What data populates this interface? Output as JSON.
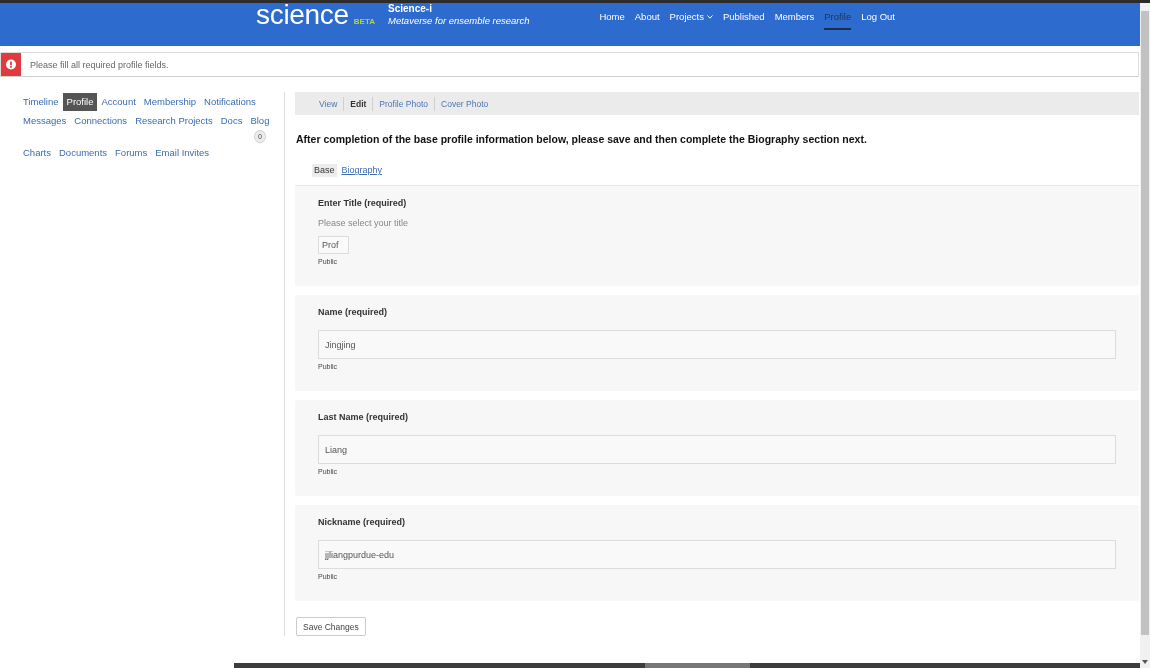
{
  "header": {
    "logo": {
      "wordmark": "science",
      "badge": "BETA"
    },
    "site_name": "Science-i",
    "tagline": "Metaverse for ensemble research",
    "nav": [
      {
        "label": "Home",
        "selected": false,
        "dropdown": false
      },
      {
        "label": "About",
        "selected": false,
        "dropdown": false
      },
      {
        "label": "Projects",
        "selected": false,
        "dropdown": true
      },
      {
        "label": "Published",
        "selected": false,
        "dropdown": false
      },
      {
        "label": "Members",
        "selected": false,
        "dropdown": false
      },
      {
        "label": "Profile",
        "selected": true,
        "dropdown": false
      },
      {
        "label": "Log Out",
        "selected": false,
        "dropdown": false
      }
    ]
  },
  "alert": {
    "kind": "error",
    "text": "Please fill all required profile fields."
  },
  "sidebar": {
    "items": [
      {
        "label": "Timeline",
        "selected": false
      },
      {
        "label": "Profile",
        "selected": true
      },
      {
        "label": "Account",
        "selected": false
      },
      {
        "label": "Membership",
        "selected": false
      },
      {
        "label": "Notifications",
        "selected": false
      },
      {
        "label": "Messages",
        "selected": false
      },
      {
        "label": "Connections",
        "selected": false
      },
      {
        "label": "Research Projects",
        "selected": false
      },
      {
        "label": "Docs",
        "selected": false
      },
      {
        "label": "Blog",
        "selected": false,
        "badge": "0"
      },
      {
        "label": "Charts",
        "selected": false
      },
      {
        "label": "Documents",
        "selected": false
      },
      {
        "label": "Forums",
        "selected": false
      },
      {
        "label": "Email Invites",
        "selected": false
      }
    ]
  },
  "subtabs": [
    {
      "label": "View",
      "selected": false
    },
    {
      "label": "Edit",
      "selected": true
    },
    {
      "label": "Profile Photo",
      "selected": false
    },
    {
      "label": "Cover Photo",
      "selected": false
    }
  ],
  "instruction": "After completion of the base profile information below, please save and then complete the Biography section next.",
  "section_tabs": [
    {
      "label": "Base",
      "selected": true
    },
    {
      "label": "Biography",
      "selected": false
    }
  ],
  "fields": [
    {
      "kind": "select",
      "label": "Enter Title (required)",
      "hint": "Please select your title",
      "value": "Prof",
      "visibility": "Public"
    },
    {
      "kind": "text",
      "label": "Name (required)",
      "value": "Jingjing",
      "visibility": "Public"
    },
    {
      "kind": "text",
      "label": "Last Name (required)",
      "value": "Liang",
      "visibility": "Public"
    },
    {
      "kind": "text",
      "label": "Nickname (required)",
      "value": "jjliangpurdue-edu",
      "visibility": "Public"
    }
  ],
  "save_button": "Save Changes"
}
